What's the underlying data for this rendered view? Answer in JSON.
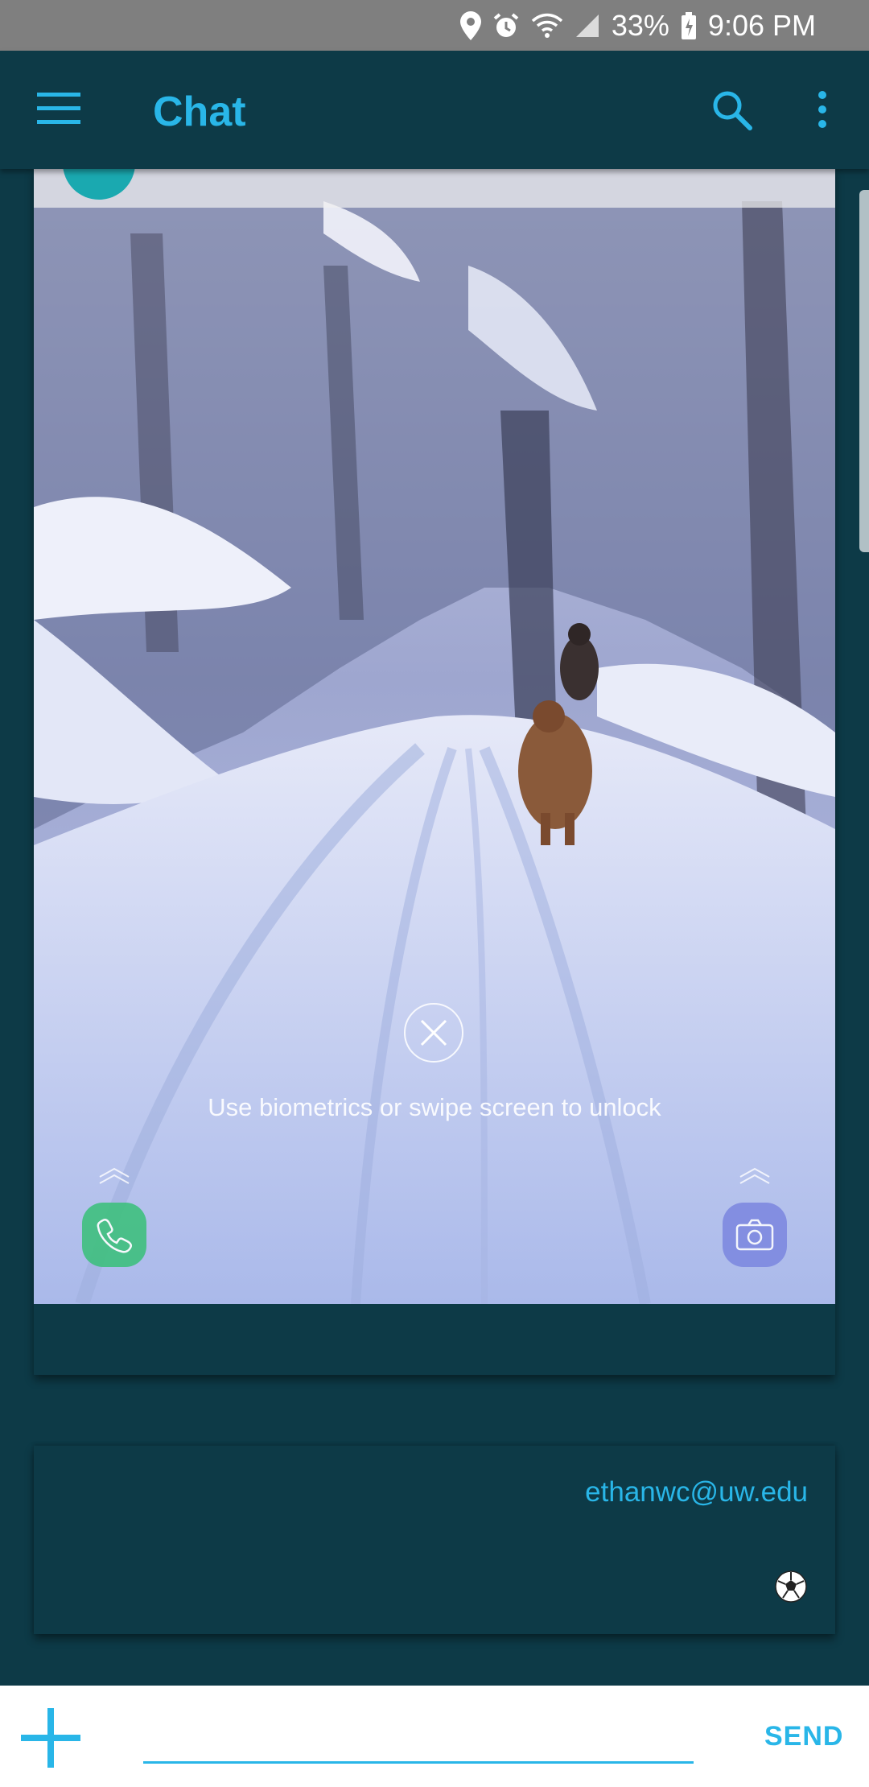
{
  "status_bar": {
    "battery": "33%",
    "time": "9:06 PM",
    "icons": [
      "location-icon",
      "alarm-icon",
      "wifi-icon",
      "signal-icon",
      "battery-charging-icon"
    ]
  },
  "app_bar": {
    "title": "Chat",
    "icons": [
      "menu-icon",
      "search-icon",
      "more-vert-icon"
    ]
  },
  "messages": [
    {
      "type": "image",
      "image_description": "snowy forest trail with two dogs, lock screen overlay",
      "lock_screen": {
        "unlock_text": "Use biometrics or swipe screen to unlock",
        "icons": [
          "close-icon",
          "phone-icon",
          "camera-icon",
          "chevron-up-icon"
        ]
      }
    },
    {
      "type": "text",
      "sender": "ethanwc@uw.edu",
      "body_icon": "soccer-ball-icon"
    }
  ],
  "composer": {
    "placeholder": "",
    "value": "",
    "send_label": "SEND",
    "add_icon": "plus-icon"
  },
  "colors": {
    "app_background": "#0d3a47",
    "accent": "#29b6e8",
    "status_bar": "#7f7f7f"
  }
}
